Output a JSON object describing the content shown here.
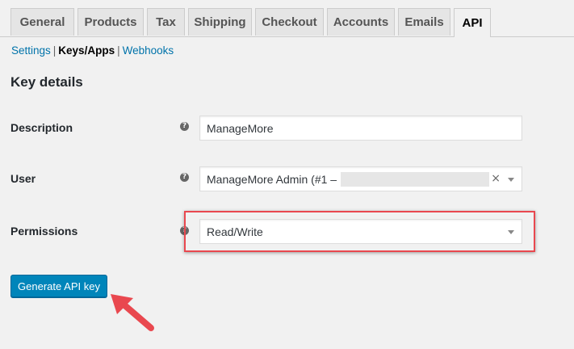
{
  "tabs": [
    {
      "label": "General"
    },
    {
      "label": "Products"
    },
    {
      "label": "Tax"
    },
    {
      "label": "Shipping"
    },
    {
      "label": "Checkout"
    },
    {
      "label": "Accounts"
    },
    {
      "label": "Emails"
    },
    {
      "label": "API"
    }
  ],
  "active_tab": "API",
  "subnav": {
    "settings": "Settings",
    "keys_apps": "Keys/Apps",
    "webhooks": "Webhooks",
    "separator": "|"
  },
  "section_title": "Key details",
  "form": {
    "description": {
      "label": "Description",
      "value": "ManageMore",
      "help_icon": "question-icon"
    },
    "user": {
      "label": "User",
      "value": "ManageMore Admin (#1 –",
      "clear": "×",
      "help_icon": "question-icon"
    },
    "permissions": {
      "label": "Permissions",
      "value": "Read/Write",
      "help_icon": "question-icon"
    }
  },
  "button": {
    "generate_label": "Generate API key"
  },
  "colors": {
    "primary_button": "#0085ba",
    "highlight": "#e9484f",
    "link": "#0073aa",
    "background": "#f1f1f1"
  }
}
